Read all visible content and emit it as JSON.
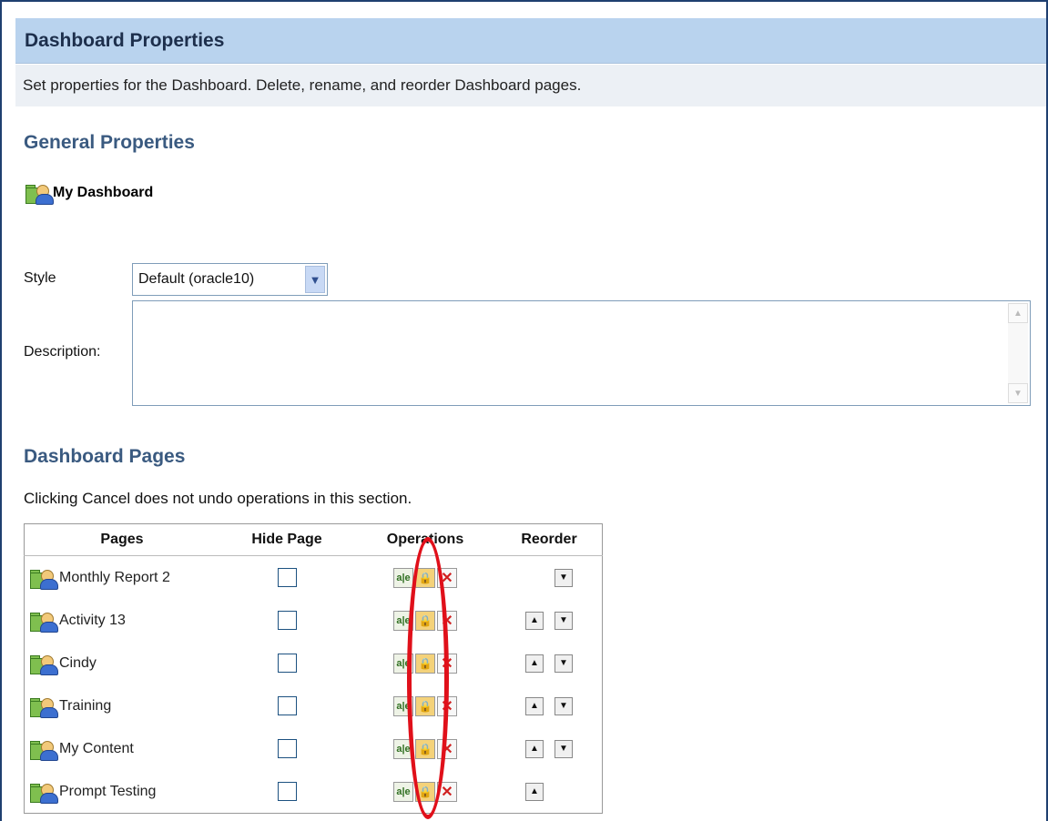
{
  "panel": {
    "title": "Dashboard Properties",
    "description": "Set properties for the Dashboard. Delete, rename, and reorder Dashboard pages."
  },
  "general": {
    "heading": "General Properties",
    "dashboard_name": "My Dashboard",
    "style_label": "Style",
    "style_value": "Default (oracle10)",
    "description_label": "Description:",
    "description_value": ""
  },
  "pages_section": {
    "heading": "Dashboard Pages",
    "note": "Clicking Cancel does not undo operations in this section.",
    "columns": [
      "Pages",
      "Hide Page",
      "Operations",
      "Reorder"
    ],
    "rows": [
      {
        "name": "Monthly Report 2",
        "hidden": false,
        "up": false,
        "down": true
      },
      {
        "name": "Activity 13",
        "hidden": false,
        "up": true,
        "down": true
      },
      {
        "name": "Cindy",
        "hidden": false,
        "up": true,
        "down": true
      },
      {
        "name": "Training",
        "hidden": false,
        "up": true,
        "down": true
      },
      {
        "name": "My Content",
        "hidden": false,
        "up": true,
        "down": true
      },
      {
        "name": "Prompt Testing",
        "hidden": false,
        "up": true,
        "down": false
      }
    ]
  },
  "icons": {
    "rename": "rename-icon",
    "permissions": "lock-icon",
    "delete": "delete-icon",
    "move_up": "arrow-up-icon",
    "move_down": "arrow-down-icon",
    "page": "dashboard-page-icon"
  },
  "annotation_color": "#e0101a"
}
